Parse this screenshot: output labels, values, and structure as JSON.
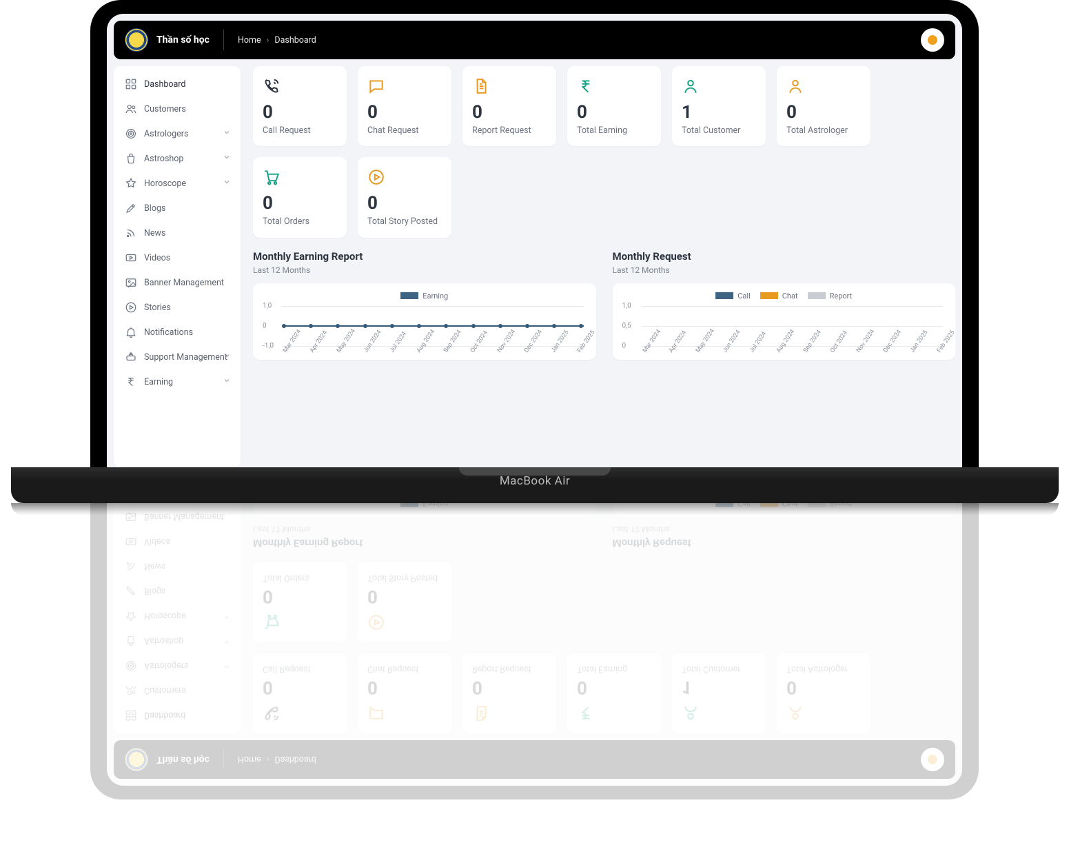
{
  "app": {
    "title": "Thần số học",
    "macbook_label": "MacBook Air"
  },
  "breadcrumb": {
    "home": "Home",
    "current": "Dashboard"
  },
  "sidebar": {
    "items": [
      {
        "label": "Dashboard",
        "icon": "dashboard",
        "chevron": false
      },
      {
        "label": "Customers",
        "icon": "users",
        "chevron": false
      },
      {
        "label": "Astrologers",
        "icon": "target",
        "chevron": true
      },
      {
        "label": "Astroshop",
        "icon": "bag",
        "chevron": true
      },
      {
        "label": "Horoscope",
        "icon": "star",
        "chevron": true
      },
      {
        "label": "Blogs",
        "icon": "pencil",
        "chevron": false
      },
      {
        "label": "News",
        "icon": "rss",
        "chevron": false
      },
      {
        "label": "Videos",
        "icon": "video",
        "chevron": false
      },
      {
        "label": "Banner Management",
        "icon": "image",
        "chevron": false
      },
      {
        "label": "Stories",
        "icon": "play",
        "chevron": false
      },
      {
        "label": "Notifications",
        "icon": "bell",
        "chevron": false
      },
      {
        "label": "Support Management",
        "icon": "support",
        "chevron": true
      },
      {
        "label": "Earning",
        "icon": "rupee",
        "chevron": true
      }
    ]
  },
  "cards": [
    {
      "icon": "phone",
      "color": "#2c3440",
      "value": "0",
      "label": "Call Request"
    },
    {
      "icon": "chat",
      "color": "#e79a1f",
      "value": "0",
      "label": "Chat Request"
    },
    {
      "icon": "report",
      "color": "#e79a1f",
      "value": "0",
      "label": "Report Request"
    },
    {
      "icon": "rupee",
      "color": "#14a085",
      "value": "0",
      "label": "Total Earning"
    },
    {
      "icon": "person",
      "color": "#14a085",
      "value": "1",
      "label": "Total Customer"
    },
    {
      "icon": "person",
      "color": "#e79a1f",
      "value": "0",
      "label": "Total Astrologer"
    },
    {
      "icon": "cart",
      "color": "#14a085",
      "value": "0",
      "label": "Total Orders"
    },
    {
      "icon": "playcir",
      "color": "#e79a1f",
      "value": "0",
      "label": "Total Story Posted"
    }
  ],
  "charts": {
    "left": {
      "title": "Monthly Earning Report",
      "sub": "Last 12 Months",
      "legend": [
        {
          "name": "Earning",
          "color": "#3d6583"
        }
      ],
      "yticks": [
        "1,0",
        "0",
        "-1,0"
      ]
    },
    "right": {
      "title": "Monthly Request",
      "sub": "Last 12 Months",
      "legend": [
        {
          "name": "Call",
          "color": "#3d6583"
        },
        {
          "name": "Chat",
          "color": "#e79a1f"
        },
        {
          "name": "Report",
          "color": "#c9ccd2"
        }
      ],
      "yticks": [
        "1,0",
        "0,5",
        "0"
      ]
    },
    "xticks": [
      "Mar 2024",
      "Apr 2024",
      "May 2024",
      "Jun 2024",
      "Jul 2024",
      "Aug 2024",
      "Sep 2024",
      "Oct 2024",
      "Nov 2024",
      "Dec 2024",
      "Jan 2025",
      "Feb 2025"
    ]
  },
  "chart_data": [
    {
      "type": "line",
      "title": "Monthly Earning Report",
      "xlabel": "",
      "ylabel": "",
      "ylim": [
        -1,
        1
      ],
      "categories": [
        "Mar 2024",
        "Apr 2024",
        "May 2024",
        "Jun 2024",
        "Jul 2024",
        "Aug 2024",
        "Sep 2024",
        "Oct 2024",
        "Nov 2024",
        "Dec 2024",
        "Jan 2025",
        "Feb 2025"
      ],
      "series": [
        {
          "name": "Earning",
          "values": [
            0,
            0,
            0,
            0,
            0,
            0,
            0,
            0,
            0,
            0,
            0,
            0
          ]
        }
      ]
    },
    {
      "type": "line",
      "title": "Monthly Request",
      "xlabel": "",
      "ylabel": "",
      "ylim": [
        0,
        1
      ],
      "categories": [
        "Mar 2024",
        "Apr 2024",
        "May 2024",
        "Jun 2024",
        "Jul 2024",
        "Aug 2024",
        "Sep 2024",
        "Oct 2024",
        "Nov 2024",
        "Dec 2024",
        "Jan 2025",
        "Feb 2025"
      ],
      "series": [
        {
          "name": "Call",
          "values": [
            0,
            0,
            0,
            0,
            0,
            0,
            0,
            0,
            0,
            0,
            0,
            0
          ]
        },
        {
          "name": "Chat",
          "values": [
            0,
            0,
            0,
            0,
            0,
            0,
            0,
            0,
            0,
            0,
            0,
            0
          ]
        },
        {
          "name": "Report",
          "values": [
            0,
            0,
            0,
            0,
            0,
            0,
            0,
            0,
            0,
            0,
            0,
            0
          ]
        }
      ]
    }
  ]
}
